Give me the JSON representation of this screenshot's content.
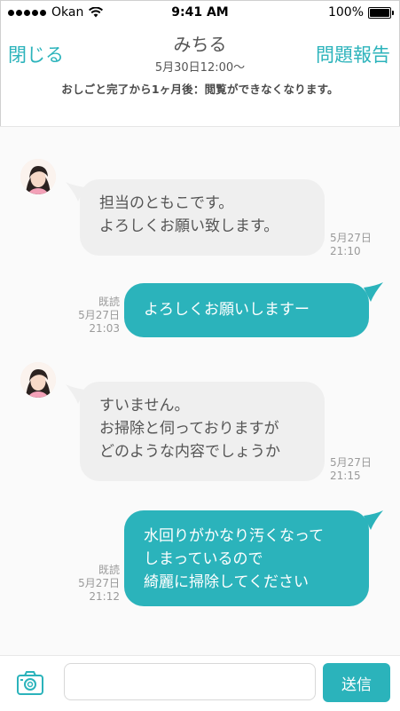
{
  "status_bar": {
    "carrier": "Okan",
    "time": "9:41 AM",
    "battery": "100%"
  },
  "header": {
    "close_label": "閉じる",
    "title": "みちる",
    "subtitle": "5月30日12:00〜",
    "report_label": "問題報告"
  },
  "notice": "おしごと完了から1ヶ月後：閲覧ができなくなります。",
  "messages": [
    {
      "direction": "incoming",
      "lines": [
        "担当のともこです。",
        "よろしくお願い致します。"
      ],
      "date": "5月27日",
      "time": "21:10"
    },
    {
      "direction": "outgoing",
      "read": "既読",
      "lines": [
        "よろしくお願いしますー"
      ],
      "date": "5月27日",
      "time": "21:03"
    },
    {
      "direction": "incoming",
      "lines": [
        "すいません。",
        "お掃除と伺っておりますが",
        "どのような内容でしょうか"
      ],
      "date": "5月27日",
      "time": "21:15"
    },
    {
      "direction": "outgoing",
      "read": "既読",
      "lines": [
        "水回りがかなり汚くなって",
        "しまっているので",
        "綺麗に掃除してください"
      ],
      "date": "5月27日",
      "time": "21:12"
    }
  ],
  "input": {
    "placeholder": "",
    "send_label": "送信"
  },
  "colors": {
    "accent": "#2bb3bb",
    "incoming_bubble": "#efefef",
    "meta_text": "#9a9a9a"
  },
  "icons": {
    "camera": "camera-icon",
    "wifi": "wifi-icon",
    "battery": "battery-icon",
    "signal": "signal-icon"
  }
}
